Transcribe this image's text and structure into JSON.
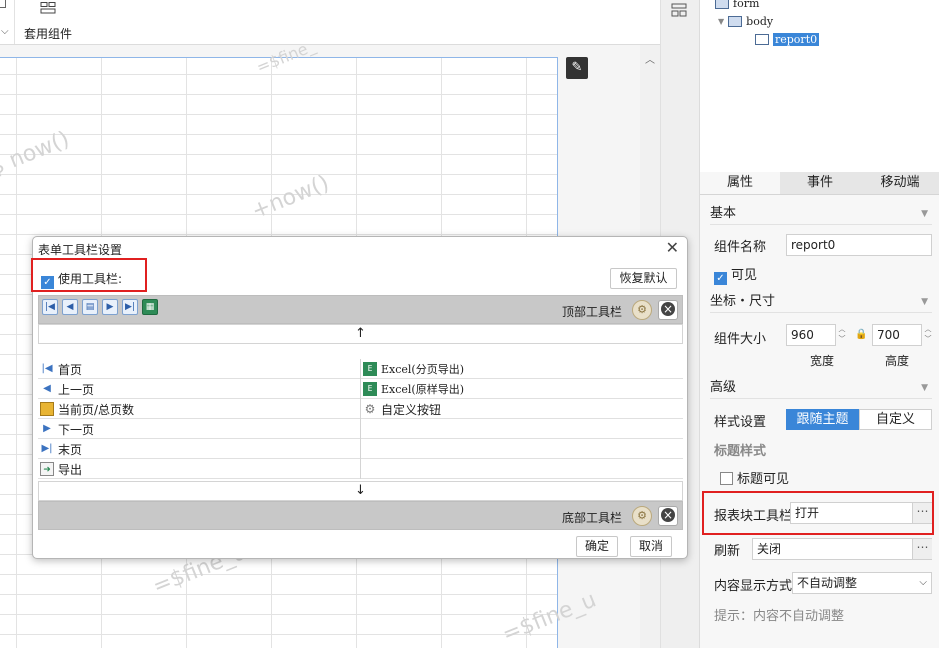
{
  "toolbar": {
    "group_label": "套用组件"
  },
  "canvas": {
    "watermarks": [
      "=$fine_",
      "=$ now()",
      "+now()",
      "=$fine_us",
      "=$fine_u"
    ]
  },
  "tree": {
    "items": [
      "form",
      "body",
      "report0"
    ]
  },
  "panel": {
    "tabs": [
      "属性",
      "事件",
      "移动端"
    ],
    "basic": {
      "header": "基本",
      "name_label": "组件名称",
      "name_value": "report0",
      "visible_label": "可见"
    },
    "coords": {
      "header": "坐标・尺寸",
      "size_label": "组件大小",
      "width_value": "960",
      "height_value": "700",
      "width_caption": "宽度",
      "height_caption": "高度"
    },
    "advanced": {
      "header": "高级",
      "style_label": "样式设置",
      "style_options": [
        "跟随主题",
        "自定义"
      ],
      "title_style_label": "标题样式",
      "title_visible_label": "标题可见",
      "report_toolbar_label": "报表块工具栏",
      "report_toolbar_value": "打开",
      "refresh_label": "刷新",
      "refresh_value": "关闭",
      "content_display_label": "内容显示方式",
      "content_display_value": "不自动调整",
      "hint": "提示：内容不自动调整"
    }
  },
  "dialog": {
    "title": "表单工具栏设置",
    "use_toolbar_label": "使用工具栏:",
    "restore_default": "恢复默认",
    "top_bar_label": "顶部工具栏",
    "bottom_bar_label": "底部工具栏",
    "left_items": [
      "首页",
      "上一页",
      "当前页/总页数",
      "下一页",
      "末页",
      "导出"
    ],
    "right_items": [
      "Excel(分页导出)",
      "Excel(原样导出)",
      "自定义按钮"
    ],
    "ok": "确定",
    "cancel": "取消"
  }
}
